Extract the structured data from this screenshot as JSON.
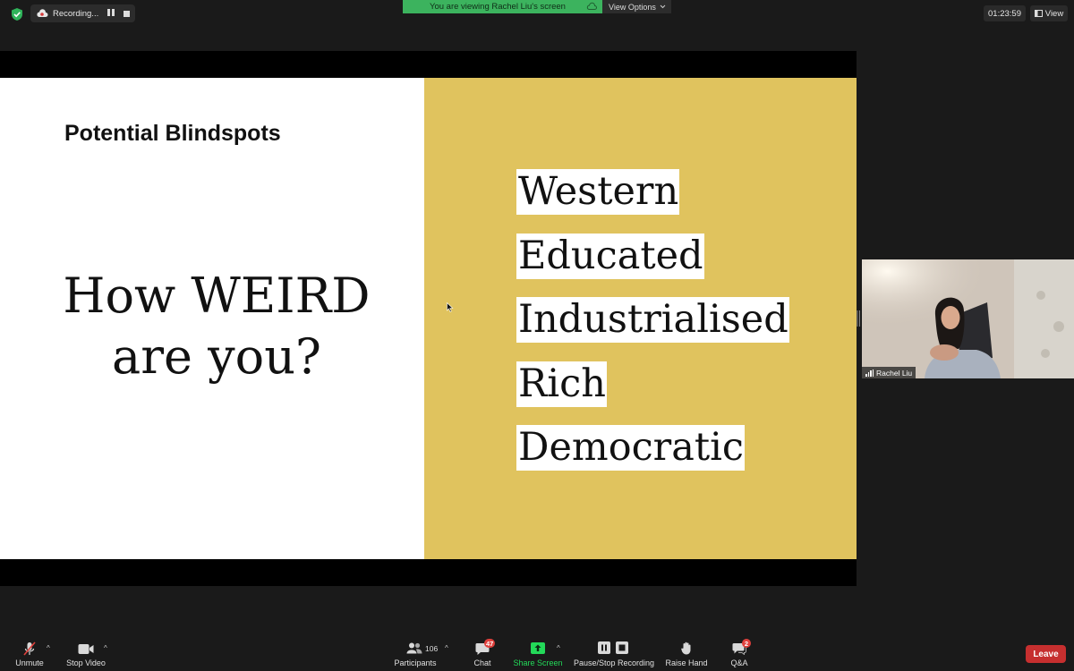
{
  "top": {
    "recording_label": "Recording...",
    "viewing_banner": "You are viewing Rachel Liu's screen",
    "view_options_label": "View Options",
    "timer": "01:23:59",
    "view_button_label": "View"
  },
  "slide": {
    "title": "Potential Blindspots",
    "question_line1": "How WEIRD",
    "question_line2": "are you?",
    "weird_items": [
      "Western",
      "Educated",
      "Industrialised",
      "Rich",
      "Democratic"
    ]
  },
  "participant_video": {
    "name": "Rachel Liu"
  },
  "toolbar": {
    "unmute_label": "Unmute",
    "stop_video_label": "Stop Video",
    "participants_label": "Participants",
    "participants_count": "106",
    "chat_label": "Chat",
    "chat_badge": "47",
    "share_screen_label": "Share Screen",
    "pause_stop_recording_label": "Pause/Stop Recording",
    "raise_hand_label": "Raise Hand",
    "qa_label": "Q&A",
    "qa_badge": "2",
    "leave_label": "Leave"
  },
  "colors": {
    "green_banner": "#3cb35e",
    "share_green": "#23d959",
    "slide_gold": "#e0c35e",
    "leave_red": "#c62f2f",
    "badge_red": "#e0403c"
  }
}
